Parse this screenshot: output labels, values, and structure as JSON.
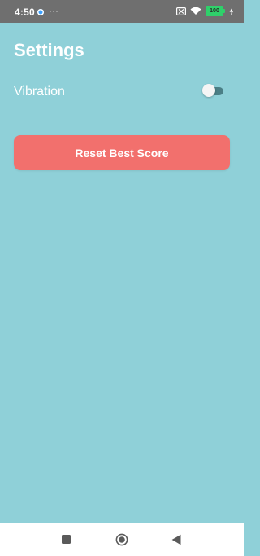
{
  "status_bar": {
    "time": "4:50",
    "more_indicator": "···",
    "battery_level": "100",
    "icons": [
      "app-notification-icon",
      "no-sim-icon",
      "wifi-icon",
      "battery-icon",
      "charging-icon"
    ]
  },
  "settings": {
    "title": "Settings",
    "vibration": {
      "label": "Vibration",
      "enabled": false
    },
    "reset_button_label": "Reset Best Score"
  },
  "nav_bar": {
    "icons": [
      "recents-icon",
      "home-icon",
      "back-icon"
    ]
  },
  "colors": {
    "background": "#8fd0d8",
    "status_bar": "#6f6f6f",
    "reset_button": "#f2706d",
    "toggle_track": "#4b7f86",
    "battery": "#2fd06a"
  }
}
